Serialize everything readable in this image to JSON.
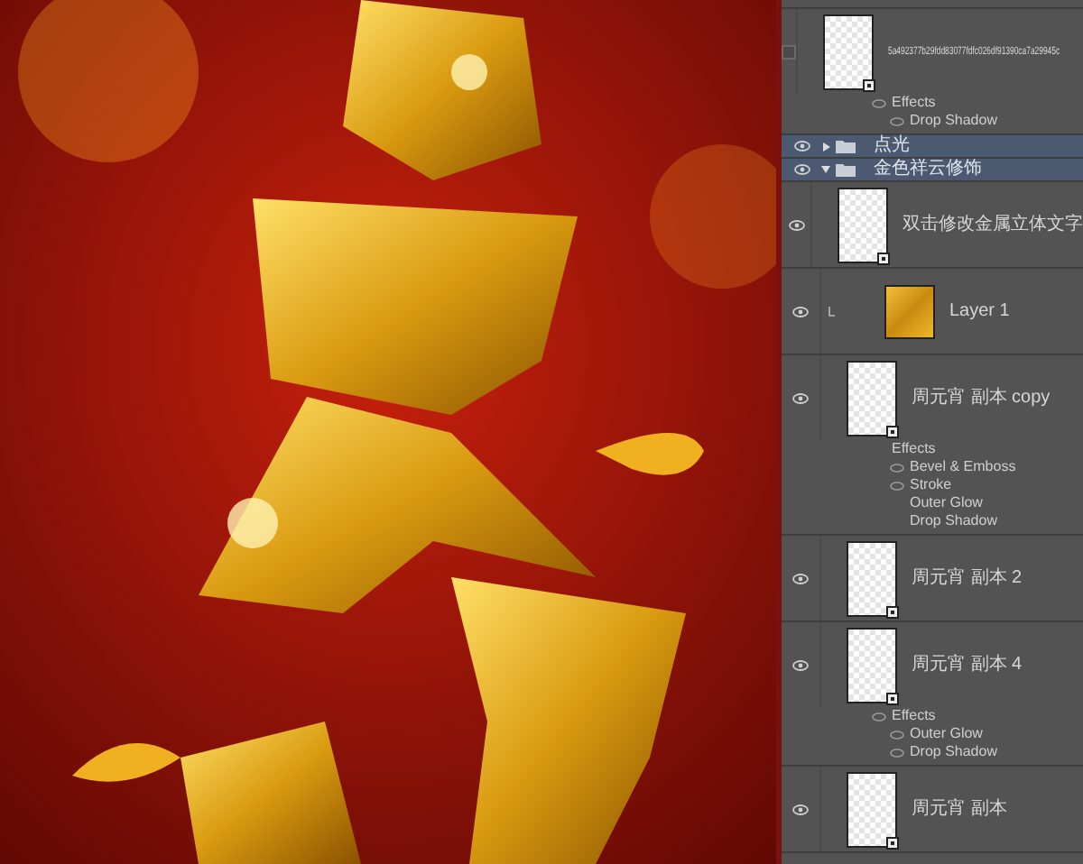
{
  "layers": [
    {
      "kind": "smart_object",
      "name": "5a492377b29fdd83077fdfc026df91390ca7a29945c",
      "visible": false,
      "clipped": false,
      "effects": {
        "label": "Effects",
        "visible": true,
        "items": [
          {
            "name": "Drop Shadow",
            "visible": true
          }
        ]
      }
    },
    {
      "kind": "group",
      "name": "点光",
      "visible": true,
      "selected": true,
      "expanded": false
    },
    {
      "kind": "group",
      "name": "金色祥云修饰",
      "visible": true,
      "selected": true,
      "expanded": true
    },
    {
      "kind": "smart_object",
      "name": "双击修改金属立体文字",
      "visible": true,
      "clipped": false
    },
    {
      "kind": "pixel",
      "name": "Layer 1",
      "visible": true,
      "clipped": true
    },
    {
      "kind": "smart_object",
      "name": "周元宵 副本 copy",
      "visible": true,
      "clipped": false,
      "effects": {
        "label": "Effects",
        "visible": false,
        "items": [
          {
            "name": "Bevel & Emboss",
            "visible": true
          },
          {
            "name": "Stroke",
            "visible": true
          },
          {
            "name": "Outer Glow",
            "visible": false
          },
          {
            "name": "Drop Shadow",
            "visible": false
          }
        ]
      }
    },
    {
      "kind": "smart_object",
      "name": "周元宵 副本 2",
      "visible": true,
      "clipped": false
    },
    {
      "kind": "smart_object",
      "name": "周元宵 副本 4",
      "visible": true,
      "clipped": false,
      "effects": {
        "label": "Effects",
        "visible": true,
        "items": [
          {
            "name": "Outer Glow",
            "visible": true
          },
          {
            "name": "Drop Shadow",
            "visible": true
          }
        ]
      }
    },
    {
      "kind": "smart_object",
      "name": "周元宵 副本",
      "visible": true,
      "clipped": false
    }
  ]
}
